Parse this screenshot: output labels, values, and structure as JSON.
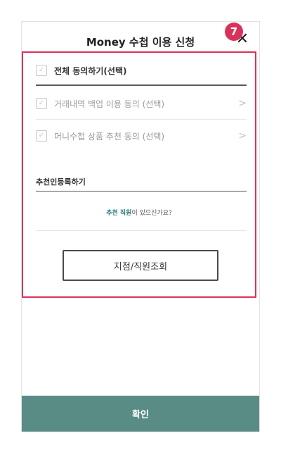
{
  "header": {
    "title": "Money 수첩 이용 신청",
    "close_icon": "close-icon",
    "close_glyph": "✕"
  },
  "step_badge": {
    "number": "7",
    "color": "#d9325a"
  },
  "agreements": {
    "all": {
      "label": "전체 동의하기(선택)",
      "checked": true
    },
    "items": [
      {
        "label": "거래내역 백업 이용 동의 (선택)",
        "checked": true,
        "chevron": ">"
      },
      {
        "label": "머니수첩 상품 추천 동의 (선택)",
        "checked": true,
        "chevron": ">"
      }
    ]
  },
  "referrer": {
    "placeholder": "추천인등록하기"
  },
  "question": {
    "link_text": "추천 직원",
    "rest_text": "이 있으신가요?"
  },
  "lookup_button": {
    "label": "지점/직원조회"
  },
  "confirm_button": {
    "label": "확인",
    "color": "#5a8c86"
  }
}
